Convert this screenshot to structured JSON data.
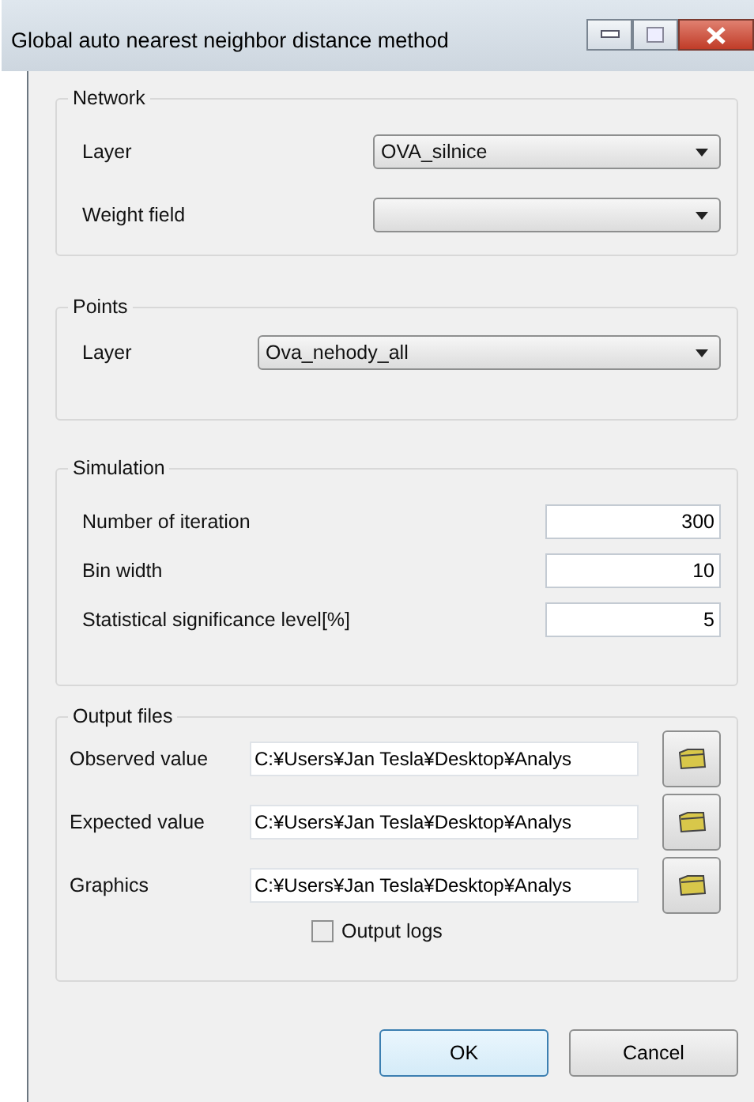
{
  "window": {
    "title": "Global auto nearest neighbor distance method"
  },
  "groups": [
    {
      "legend": "Network",
      "rows": [
        {
          "kind": "dropdown",
          "label": "Layer",
          "value": "OVA_silnice"
        },
        {
          "kind": "dropdown",
          "label": "Weight field"
        }
      ]
    },
    {
      "legend": "Points",
      "rows": [
        {
          "kind": "dropdown",
          "label": "Layer",
          "value": "Ova_nehody_all"
        }
      ]
    },
    {
      "legend": "Simulation",
      "rows": [
        {
          "kind": "number",
          "label": "Number of iteration",
          "value": "300"
        },
        {
          "kind": "number",
          "label": "Bin width",
          "value": "10"
        },
        {
          "kind": "number",
          "label": "Statistical significance level[%]",
          "value": "5"
        }
      ]
    },
    {
      "legend": "Output files",
      "rows": [
        {
          "kind": "path",
          "label": "Observed value",
          "value": "C:¥Users¥Jan Tesla¥Desktop¥Analys"
        },
        {
          "kind": "path",
          "label": "Expected value",
          "value": "C:¥Users¥Jan Tesla¥Desktop¥Analys"
        },
        {
          "kind": "path",
          "label": "Graphics",
          "value": "C:¥Users¥Jan Tesla¥Desktop¥Analys"
        },
        {
          "kind": "checkbox",
          "label": "Output logs",
          "checked": false
        }
      ]
    }
  ],
  "buttons": [
    {
      "label": "OK",
      "default": true
    },
    {
      "label": "Cancel",
      "default": false
    }
  ]
}
